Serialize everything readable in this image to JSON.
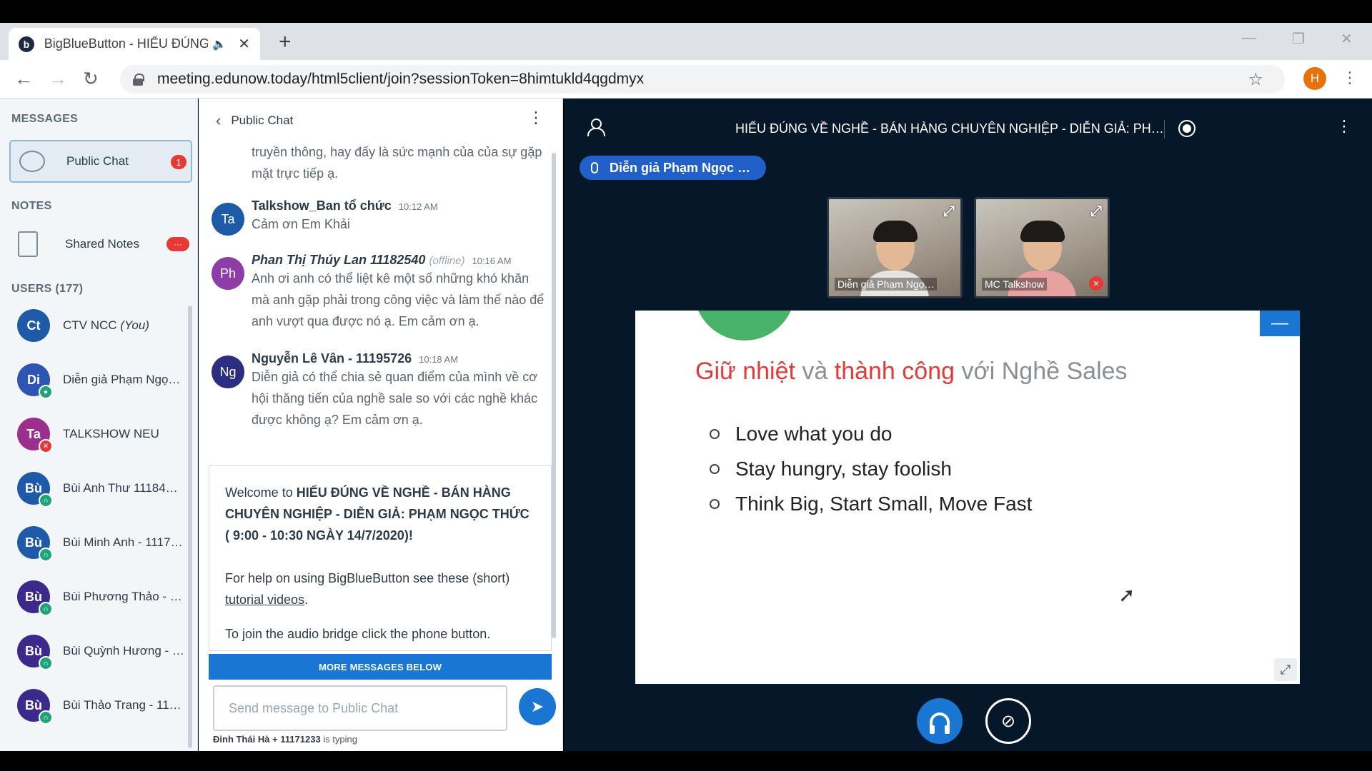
{
  "browser": {
    "tab_title": "BigBlueButton - HIỂU ĐÚNG",
    "favicon_letter": "b",
    "url": "meeting.edunow.today/html5client/join?sessionToken=8himtukld4qgdmyx",
    "profile_initial": "H"
  },
  "sidebar": {
    "messages_title": "MESSAGES",
    "public_chat_label": "Public Chat",
    "public_chat_badge": "1",
    "notes_title": "NOTES",
    "shared_notes_label": "Shared Notes",
    "shared_notes_badge": "···",
    "users_title": "USERS (177)",
    "users": [
      {
        "initials": "Ct",
        "name": "CTV NCC",
        "suffix": "(You)",
        "color": "#1f5aa8",
        "status": "none"
      },
      {
        "initials": "Di",
        "name": "Diễn giả Phạm Ngọ…",
        "suffix": "",
        "color": "#2d55b3",
        "status": "mic"
      },
      {
        "initials": "Ta",
        "name": "TALKSHOW NEU",
        "suffix": "",
        "color": "#9c2f8e",
        "status": "muted"
      },
      {
        "initials": "Bù",
        "name": "Bùi Anh Thư 111847…",
        "suffix": "",
        "color": "#1f5aa8",
        "status": "listen"
      },
      {
        "initials": "Bù",
        "name": "Bùi Minh Anh - 1117…",
        "suffix": "",
        "color": "#1f5aa8",
        "status": "listen"
      },
      {
        "initials": "Bù",
        "name": "Bùi Phương Thảo - …",
        "suffix": "",
        "color": "#3b2a8c",
        "status": "listen"
      },
      {
        "initials": "Bù",
        "name": "Bùi Quỳnh Hương - …",
        "suffix": "",
        "color": "#3b2a8c",
        "status": "listen"
      },
      {
        "initials": "Bù",
        "name": "Bùi Thảo Trang - 11…",
        "suffix": "",
        "color": "#3b2a8c",
        "status": "listen"
      }
    ]
  },
  "chat": {
    "header": "Public Chat",
    "messages": [
      {
        "author": "",
        "offline": "",
        "time": "",
        "initials": "",
        "color": "",
        "text": "truyền thông, hay đấy là sức mạnh của của sự gặp mặt trực tiếp ạ."
      },
      {
        "author": "Talkshow_Ban tổ chức",
        "offline": "",
        "time": "10:12 AM",
        "initials": "Ta",
        "color": "#1f5aa8",
        "text": "Cảm ơn Em Khải"
      },
      {
        "author": "Phan Thị Thúy Lan 11182540",
        "offline": "(offline)",
        "time": "10:16 AM",
        "initials": "Ph",
        "color": "#8e3ca8",
        "text": "Anh ơi anh có thể liệt kê một số những khó khăn mà anh gặp phải trong công việc và làm thế nào để anh vượt qua được nó ạ. Em cảm ơn ạ."
      },
      {
        "author": "Nguyễn Lê Vân - 11195726",
        "offline": "",
        "time": "10:18 AM",
        "initials": "Ng",
        "color": "#2b2e82",
        "text": "Diễn giả có thể chia sẻ quan điểm của mình về cơ hội thăng tiến của nghề sale so với các nghề khác được không ạ? Em cảm ơn ạ."
      }
    ],
    "welcome_prefix": "Welcome to ",
    "welcome_bold": "HIỂU ĐÚNG VỀ NGHỀ - BÁN HÀNG CHUYÊN NGHIỆP - DIỄN GIẢ: PHẠM NGỌC THỨC ( 9:00 - 10:30 NGÀY 14/7/2020)",
    "welcome_suffix": "!",
    "help_prefix": "For help on using BigBlueButton see these (short) ",
    "help_link": "tutorial videos",
    "help_suffix": ".",
    "audio_hint": "To join the audio bridge click the phone button.",
    "more_messages": "MORE MESSAGES BELOW",
    "input_placeholder": "Send message to Public Chat",
    "typing_user": "Đinh Thái Hà + 11171233",
    "typing_suffix": " is typing"
  },
  "main": {
    "meeting_title": "HIỂU ĐÚNG VỀ NGHỀ - BÁN HÀNG CHUYÊN NGHIỆP - DIỄN GIẢ: PH…",
    "talker": "Diễn giả Phạm Ngọc …",
    "videos": [
      {
        "label": "Diễn giả Phạm Ngọ…",
        "muted": false
      },
      {
        "label": "MC Talkshow",
        "muted": true
      }
    ],
    "slide": {
      "title_part1": "Giữ nhiệt",
      "title_part2": " và ",
      "title_part3": "thành công",
      "title_part4": " với Nghề Sales",
      "bullets": [
        "Love what you do",
        "Stay hungry, stay foolish",
        "Think Big, Start Small, Move Fast"
      ]
    }
  },
  "colors": {
    "accent": "#1976d2",
    "badge_red": "#e53935",
    "slide_green": "#48b26b",
    "main_bg": "#06172a"
  }
}
